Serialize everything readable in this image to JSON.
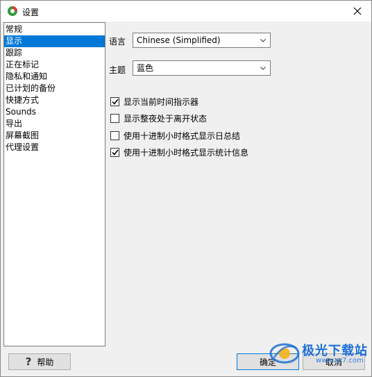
{
  "window": {
    "title": "设置"
  },
  "sidebar": {
    "items": [
      {
        "label": "常规",
        "active": false
      },
      {
        "label": "显示",
        "active": true
      },
      {
        "label": "跟踪",
        "active": false
      },
      {
        "label": "正在标记",
        "active": false
      },
      {
        "label": "隐私和通知",
        "active": false
      },
      {
        "label": "已计划的备份",
        "active": false
      },
      {
        "label": "快捷方式",
        "active": false
      },
      {
        "label": "Sounds",
        "active": false
      },
      {
        "label": "导出",
        "active": false
      },
      {
        "label": "屏幕截图",
        "active": false
      },
      {
        "label": "代理设置",
        "active": false
      }
    ]
  },
  "display": {
    "language": {
      "label": "语言",
      "value": "Chinese (Simplified)"
    },
    "theme": {
      "label": "主题",
      "value": "蓝色"
    },
    "options": [
      {
        "label": "显示当前时间指示器",
        "checked": true
      },
      {
        "label": "显示整夜处于离开状态",
        "checked": false
      },
      {
        "label": "使用十进制小时格式显示日总结",
        "checked": false
      },
      {
        "label": "使用十进制小时格式显示统计信息",
        "checked": true
      }
    ]
  },
  "buttons": {
    "help": "帮助",
    "ok": "确定",
    "cancel": "取消"
  },
  "watermark": {
    "text": "极光下载站",
    "url": "www.xz7.com"
  },
  "colors": {
    "accent": "#0078d7",
    "watermark": "#1e6fd6"
  }
}
